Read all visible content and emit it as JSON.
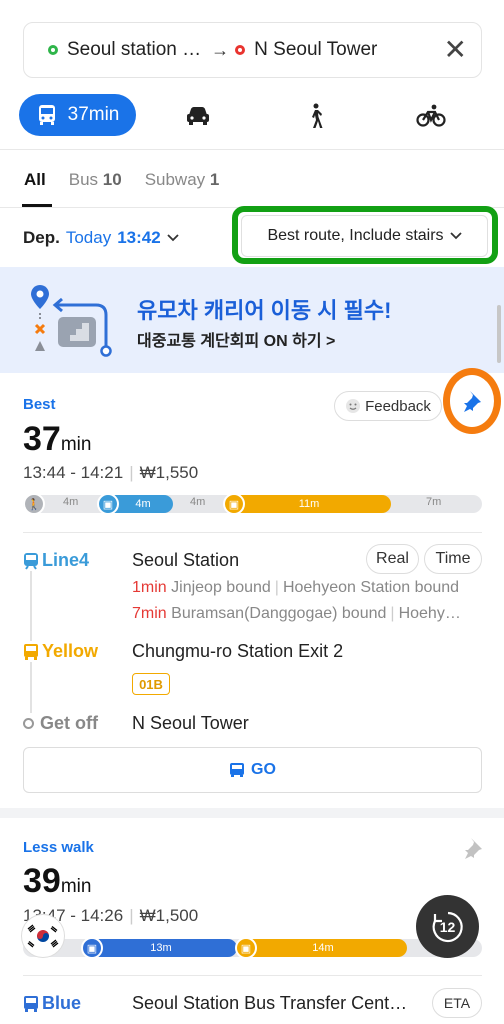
{
  "search": {
    "origin": "Seoul station …",
    "arrow": "→",
    "destination": "N Seoul Tower"
  },
  "modes": {
    "transit_time": "37min"
  },
  "tabs": [
    {
      "label": "All",
      "count": ""
    },
    {
      "label": "Bus",
      "count": "10"
    },
    {
      "label": "Subway",
      "count": "1"
    }
  ],
  "departure": {
    "label": "Dep.",
    "day": "Today",
    "time": "13:42",
    "sort_option": "Best route, Include stairs"
  },
  "banner": {
    "title": "유모차 캐리어 이동 시 필수!",
    "subtitle": "대중교통 계단회피 ON 하기 >"
  },
  "route1": {
    "badge": "Best",
    "feedback": "Feedback",
    "duration": "37",
    "duration_unit": "min",
    "time_range": "13:44 - 14:21",
    "fare": "₩1,550",
    "segments": [
      "4m",
      "4m",
      "4m",
      "11m",
      "7m"
    ],
    "steps": [
      {
        "label": "Line4",
        "place": "Seoul Station",
        "chips": [
          "Real",
          "Time"
        ]
      },
      {
        "label": "Yellow",
        "place": "Chungmu-ro Station Exit 2",
        "tag": "01B"
      },
      {
        "label": "Get off",
        "place": "N Seoul Tower"
      }
    ],
    "arrivals": [
      {
        "min": "1min",
        "text": "Jinjeop bound",
        "text2": "Hoehyeon Station bound"
      },
      {
        "min": "7min",
        "text": "Buramsan(Danggogae) bound",
        "text2": "Hoehy…"
      }
    ],
    "go": "GO"
  },
  "route2": {
    "badge": "Less walk",
    "duration": "39",
    "duration_unit": "min",
    "time_range": "13:47 - 14:26",
    "fare": "₩1,500",
    "segments": [
      "13m",
      "14m"
    ],
    "step": {
      "label": "Blue",
      "place": "Seoul Station Bus Transfer Cent…",
      "chip": "ETA"
    }
  },
  "fab": {
    "label": "12"
  },
  "colors": {
    "accent": "#1a73e8",
    "subway_line4": "#3a9bd9",
    "bus_yellow": "#f2a900",
    "bus_blue": "#2f6fd6",
    "highlight_green": "#12a014",
    "highlight_orange": "#f57c0f"
  }
}
